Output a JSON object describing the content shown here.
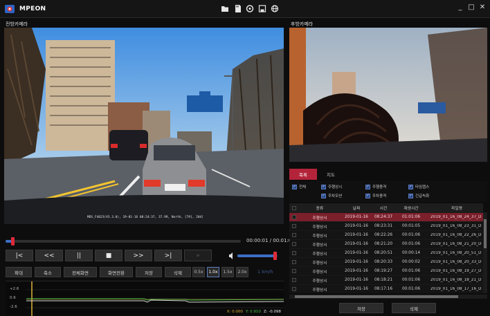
{
  "app": {
    "title": "MPEON"
  },
  "toolbar": {
    "icons": [
      "folder-icon",
      "sd-card-icon",
      "settings-icon",
      "save-icon",
      "globe-icon"
    ]
  },
  "window_controls": {
    "minimize": "_",
    "maximize": "□",
    "close": "✕"
  },
  "front_camera": {
    "label": "전방카메라",
    "overlay": "MDS_F4023(V3.3.0), 19-01-16 08:24:37, 37.99, North, [79], 204]"
  },
  "rear_camera": {
    "label": "후방카메라"
  },
  "playback": {
    "time": "00:00:01 / 00:01:06",
    "progress": 0.03,
    "volume": 0.95
  },
  "transport": [
    "|<",
    "<<",
    "||",
    "■",
    ">>",
    ">|",
    "»"
  ],
  "actions": [
    "확대",
    "축소",
    "전체화면",
    "화면전환",
    "저장",
    "삭제"
  ],
  "speeds": {
    "options": [
      "0.5x",
      "1.0x",
      "1.5x",
      "2.0x"
    ],
    "selected": "1.0x",
    "readout": "1 km/h"
  },
  "gsensor": {
    "labels": [
      "+2.6",
      "0.6",
      "-2.6"
    ],
    "x": "X: 0.000",
    "y": "Y: 0.910",
    "z": "Z: -0.098",
    "colors": {
      "x": "#e0b23a",
      "y": "#4ec44a",
      "z": "#e8e8e8"
    }
  },
  "panel": {
    "tabs": [
      "목록",
      "지도"
    ],
    "active_tab": "목록",
    "filters": [
      {
        "label": "전체",
        "checked": true
      },
      {
        "label": "주행상시",
        "checked": true
      },
      {
        "label": "주행충격",
        "checked": true
      },
      {
        "label": "타임랩스",
        "checked": true
      },
      {
        "label": "주차모션",
        "checked": true
      },
      {
        "label": "주차충격",
        "checked": true
      },
      {
        "label": "긴급녹화",
        "checked": true
      }
    ],
    "columns": [
      "종류",
      "날짜",
      "시간",
      "재생시간",
      "파일명"
    ],
    "rows": [
      [
        "주행상시",
        "2019-01-16",
        "08:24:37",
        "01:01:06",
        "2019_01_16_08_24_37_D"
      ],
      [
        "주행상시",
        "2019-01-16",
        "08:23:31",
        "00:01:05",
        "2019_01_16_08_23_31_D"
      ],
      [
        "주행상시",
        "2019-01-16",
        "08:22:26",
        "00:01:06",
        "2019_01_16_08_22_26_D"
      ],
      [
        "주행상시",
        "2019-01-16",
        "08:21:20",
        "00:01:06",
        "2019_01_16_08_21_20_D"
      ],
      [
        "주행상시",
        "2019-01-16",
        "08:20:51",
        "00:00:14",
        "2019_01_16_08_20_51_D"
      ],
      [
        "주행상시",
        "2019-01-16",
        "08:20:33",
        "00:00:02",
        "2019_01_16_08_20_33_D"
      ],
      [
        "주행상시",
        "2019-01-16",
        "08:19:27",
        "00:01:06",
        "2019_01_16_08_19_27_D"
      ],
      [
        "주행상시",
        "2019-01-16",
        "08:18:21",
        "00:01:06",
        "2019_01_16_08_18_21_D"
      ],
      [
        "주행상시",
        "2019-01-16",
        "08:17:16",
        "00:01:06",
        "2019_01_16_08_17_16_D"
      ]
    ],
    "selected_row": 0,
    "save_label": "저장",
    "delete_label": "삭제"
  }
}
